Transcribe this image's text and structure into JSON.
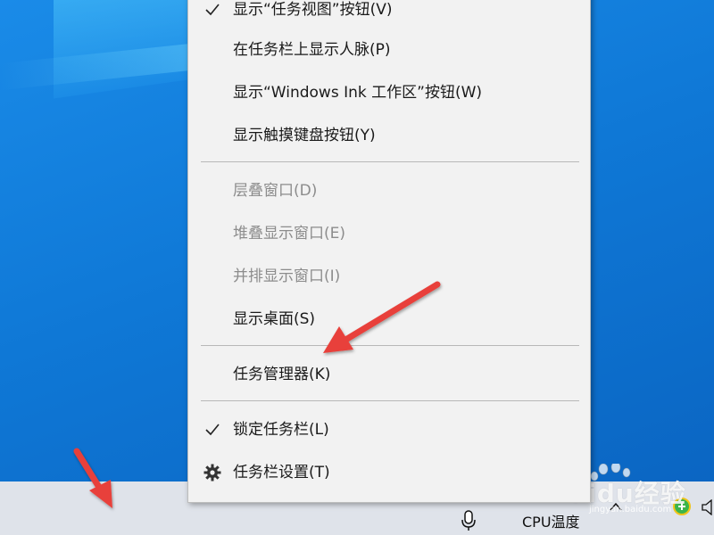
{
  "menu": {
    "items": [
      {
        "label": "显示“任务视图”按钮(V)",
        "checked": true,
        "disabled": false
      },
      {
        "label": "在任务栏上显示人脉(P)",
        "checked": false,
        "disabled": false
      },
      {
        "label": "显示“Windows Ink 工作区”按钮(W)",
        "checked": false,
        "disabled": false
      },
      {
        "label": "显示触摸键盘按钮(Y)",
        "checked": false,
        "disabled": false
      },
      {
        "label": "层叠窗口(D)",
        "checked": false,
        "disabled": true
      },
      {
        "label": "堆叠显示窗口(E)",
        "checked": false,
        "disabled": true
      },
      {
        "label": "并排显示窗口(I)",
        "checked": false,
        "disabled": true
      },
      {
        "label": "显示桌面(S)",
        "checked": false,
        "disabled": false
      },
      {
        "label": "任务管理器(K)",
        "checked": false,
        "disabled": false
      },
      {
        "label": "锁定任务栏(L)",
        "checked": true,
        "disabled": false
      },
      {
        "label": "任务栏设置(T)",
        "checked": false,
        "disabled": false,
        "icon": "gear-icon"
      }
    ]
  },
  "taskbar": {
    "cpu_label": "CPU温度",
    "icons": [
      "microphone-icon",
      "chevron-up-icon",
      "green-plus-badge-icon",
      "speaker-icon"
    ]
  },
  "watermark": {
    "text": "Baidu经验",
    "url": "jingyan.baidu.com"
  },
  "colors": {
    "desktop": "#0f78d6",
    "menu_bg": "#f2f2f2",
    "taskbar_bg": "#dfe3ea",
    "arrow": "#e8403a",
    "disabled_text": "#8c8c8c"
  }
}
